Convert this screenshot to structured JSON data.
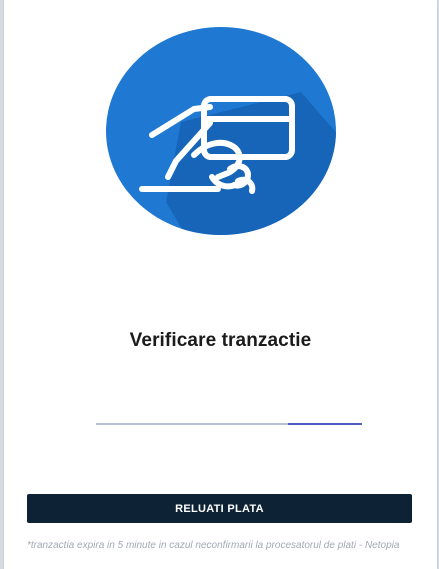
{
  "header": {
    "illustration_icon": "card-in-hand-icon"
  },
  "main": {
    "title": "Verificare tranzactie",
    "progress": {
      "start": 0.72,
      "end": 1.0
    },
    "retry_button_label": "RELUATI PLATA",
    "footnote": "*tranzactia expira in 5 minute in cazul neconfirmarii la procesatorul de plati - Netopia"
  },
  "colors": {
    "circle": "#1f79d3",
    "circle_shadow": "#1662b4",
    "button_bg": "#0e2236",
    "progress_track": "#b9bed9",
    "progress_fill": "#4b5ec0"
  }
}
